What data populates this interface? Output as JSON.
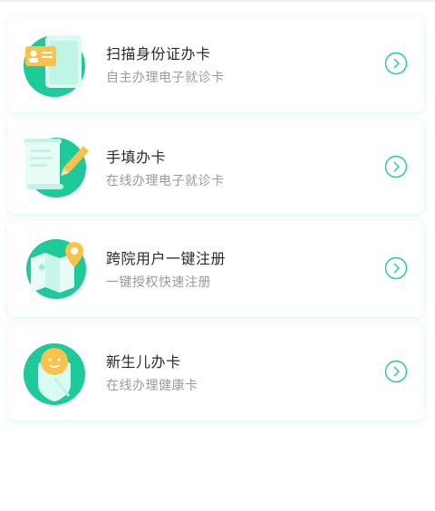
{
  "colors": {
    "accent": "#1ec99a",
    "title": "#2b2b2b",
    "subtitle": "#9a9a9a",
    "card_shadow": "#d8f5ec",
    "yellow": "#f9c24c"
  },
  "items": [
    {
      "title": "扫描身份证办卡",
      "subtitle": "自主办理电子就诊卡",
      "icon": "id-card-scan-icon"
    },
    {
      "title": "手填办卡",
      "subtitle": "在线办理电子就诊卡",
      "icon": "form-pencil-icon"
    },
    {
      "title": "跨院用户一键注册",
      "subtitle": "一键授权快速注册",
      "icon": "map-pin-icon"
    },
    {
      "title": "新生儿办卡",
      "subtitle": "在线办理健康卡",
      "icon": "newborn-baby-icon"
    }
  ]
}
